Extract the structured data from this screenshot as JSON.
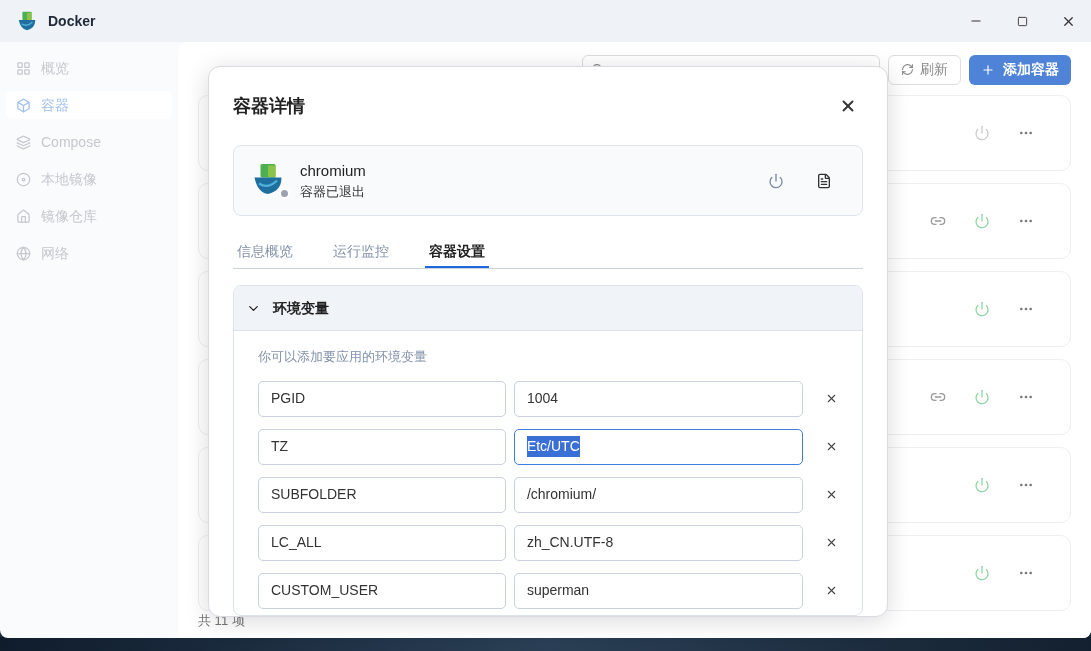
{
  "window": {
    "title": "Docker"
  },
  "sidebar": {
    "items": [
      {
        "label": "概览",
        "selected": false
      },
      {
        "label": "容器",
        "selected": true
      },
      {
        "label": "Compose",
        "selected": false
      },
      {
        "label": "本地镜像",
        "selected": false
      },
      {
        "label": "镜像仓库",
        "selected": false
      },
      {
        "label": "网络",
        "selected": false
      }
    ]
  },
  "page": {
    "refresh_button": "刷新",
    "add_button": "添加容器",
    "footer": "共 11 项",
    "cards": [
      {
        "running": false,
        "link": false
      },
      {
        "running": true,
        "link": true
      },
      {
        "running": true,
        "link": false
      },
      {
        "running": true,
        "link": true
      },
      {
        "running": true,
        "link": false
      },
      {
        "running": true,
        "link": false
      }
    ]
  },
  "dialog": {
    "title": "容器详情",
    "container": {
      "name": "chromium",
      "status": "容器已退出",
      "running": false
    },
    "tabs": [
      {
        "label": "信息概览",
        "selected": false
      },
      {
        "label": "运行监控",
        "selected": false
      },
      {
        "label": "容器设置",
        "selected": true
      }
    ],
    "section": {
      "title": "环境变量",
      "expanded": true,
      "hint": "你可以添加要应用的环境变量",
      "rows": [
        {
          "key": "PGID",
          "value": "1004",
          "focused": false
        },
        {
          "key": "TZ",
          "value": "Etc/UTC",
          "focused": true
        },
        {
          "key": "SUBFOLDER",
          "value": "/chromium/",
          "focused": false
        },
        {
          "key": "LC_ALL",
          "value": "zh_CN.UTF-8",
          "focused": false
        },
        {
          "key": "CUSTOM_USER",
          "value": "superman",
          "focused": false
        }
      ]
    }
  }
}
